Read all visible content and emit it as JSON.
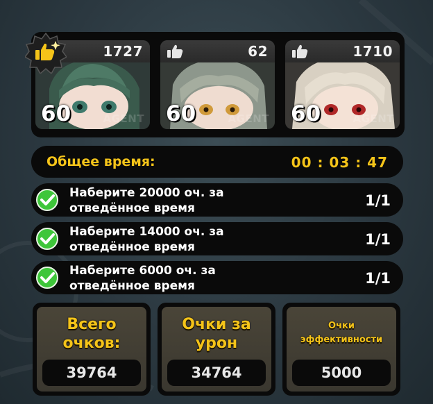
{
  "characters": [
    {
      "score": "1727",
      "level": "60",
      "tag": "AGENT",
      "icon": "thumbs-up-icon",
      "highlighted": true
    },
    {
      "score": "62",
      "level": "60",
      "tag": "AGENT",
      "icon": "thumbs-up-icon",
      "highlighted": false
    },
    {
      "score": "1710",
      "level": "60",
      "tag": "AGENT",
      "icon": "thumbs-up-icon",
      "highlighted": false
    }
  ],
  "timer": {
    "label": "Общее время:",
    "value": "00 : 03 : 47"
  },
  "tasks": [
    {
      "line1": "Наберите 20000 оч. за",
      "line2": "отведённое время",
      "progress": "1/1",
      "done": true
    },
    {
      "line1": "Наберите 14000 оч. за",
      "line2": "отведённое время",
      "progress": "1/1",
      "done": true
    },
    {
      "line1": "Наберите 6000 оч. за",
      "line2": "отведённое время",
      "progress": "1/1",
      "done": true
    }
  ],
  "stats": [
    {
      "line1": "Всего",
      "line2": "очков:",
      "value": "39764"
    },
    {
      "line1": "Очки за",
      "line2": "урон",
      "value": "34764"
    },
    {
      "line1": "Очки",
      "line2": "эффективности",
      "value": "5000"
    }
  ],
  "colors": {
    "accent": "#f5c419",
    "check": "#3ec63a",
    "panel": "#0a0a0a"
  }
}
